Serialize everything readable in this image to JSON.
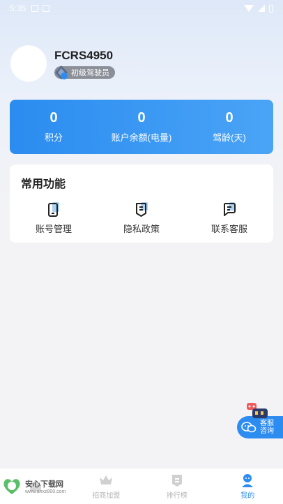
{
  "status_bar": {
    "time": "5:35"
  },
  "profile": {
    "username": "FCRS4950",
    "level": "初级驾驶员"
  },
  "stats": [
    {
      "value": "0",
      "label": "积分"
    },
    {
      "value": "0",
      "label": "账户余额(电量)"
    },
    {
      "value": "0",
      "label": "驾龄(天)"
    }
  ],
  "functions": {
    "title": "常用功能",
    "items": [
      {
        "label": "账号管理",
        "icon": "phone-icon"
      },
      {
        "label": "隐私政策",
        "icon": "document-icon"
      },
      {
        "label": "联系客服",
        "icon": "chat-icon"
      }
    ]
  },
  "service_button": {
    "line1": "客服",
    "line2": "咨询"
  },
  "tabbar": {
    "items": [
      {
        "label": "",
        "icon": "home-icon",
        "active": false
      },
      {
        "label": "招商加盟",
        "icon": "crown-icon",
        "active": false
      },
      {
        "label": "排行榜",
        "icon": "ranking-icon",
        "active": false
      },
      {
        "label": "我的",
        "icon": "user-icon",
        "active": true
      }
    ]
  },
  "watermark": {
    "title": "安心下载网",
    "url": "www.anxz800.com"
  },
  "colors": {
    "accent": "#2d8cf0",
    "card_gradient_start": "#2b8cf0",
    "card_gradient_end": "#4aa4f6"
  }
}
